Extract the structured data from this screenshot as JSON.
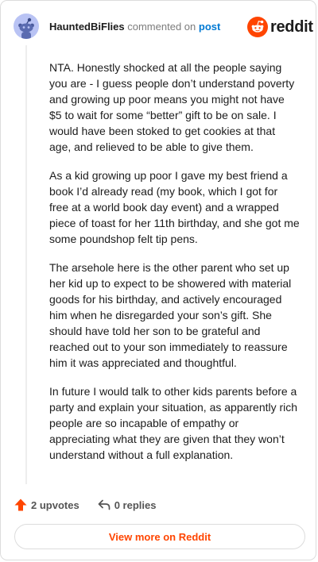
{
  "comment": {
    "username": "HauntedBiFlies",
    "commented_on": "commented on",
    "post_link": "post",
    "paragraphs": [
      "NTA. Honestly shocked at all the people saying you are - I guess people don’t understand poverty and growing up poor means you might not have $5 to wait for some “better” gift to be on sale. I would have been stoked to get cookies at that age, and relieved to be able to give them.",
      "As a kid growing up poor I gave my best friend a book I’d already read (my book, which I got for free at a world book day event) and a wrapped piece of toast for her 11th birthday, and she got me some poundshop felt tip pens.",
      "The arsehole here is the other parent who set up her kid up to expect to be showered with material goods for his birthday, and actively encouraged him when he disregarded your son’s gift. She should have told her son to be grateful and reached out to your son immediately to reassure him it was appreciated and thoughtful.",
      "In future I would talk to other kids parents before a party and explain your situation, as apparently rich people are so incapable of empathy or appreciating what they are given that they won’t understand without a full explanation."
    ]
  },
  "logo": {
    "wordmark": "reddit",
    "icon": "reddit-snoo-icon",
    "color": "#ff4500"
  },
  "actions": {
    "upvotes": "2 upvotes",
    "replies": "0 replies",
    "upvote_icon": "upvote-arrow-icon",
    "reply_icon": "reply-arrow-icon"
  },
  "footer": {
    "view_more": "View more on Reddit"
  },
  "colors": {
    "accent": "#ff4500",
    "link": "#0079d3",
    "avatar_bg": "#b9c3f4"
  }
}
